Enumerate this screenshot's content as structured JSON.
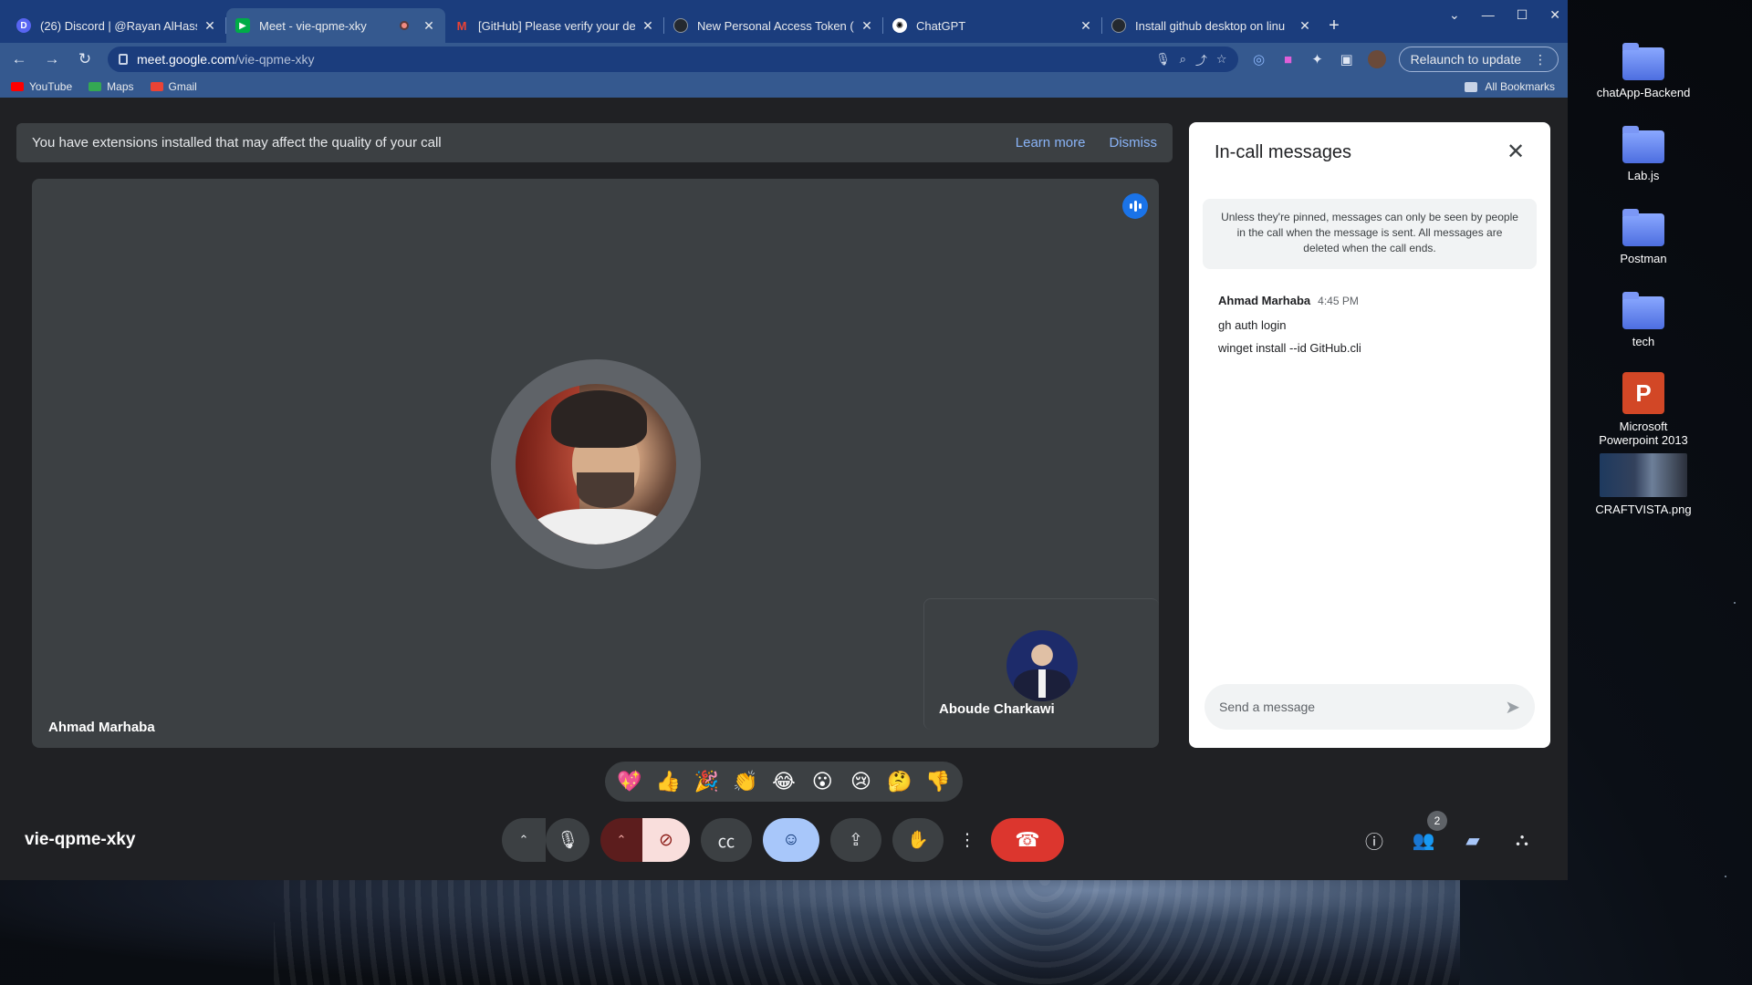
{
  "browser": {
    "tabs": [
      {
        "title": "(26) Discord | @Rayan AlHass",
        "icon": "discord-icon",
        "color": "#5865f2",
        "badge": "26",
        "active": false
      },
      {
        "title": "Meet - vie-qpme-xky",
        "icon": "meet-icon",
        "color": "#00ac47",
        "active": true,
        "recording": true
      },
      {
        "title": "[GitHub] Please verify your de",
        "icon": "gmail-icon",
        "color": "#ea4335",
        "active": false
      },
      {
        "title": "New Personal Access Token (",
        "icon": "github-icon",
        "color": "#24292f",
        "active": false
      },
      {
        "title": "ChatGPT",
        "icon": "chatgpt-icon",
        "color": "#ffffff",
        "active": false
      },
      {
        "title": "Install github desktop on linu",
        "icon": "github-icon",
        "color": "#24292f",
        "active": false
      }
    ],
    "address": {
      "host": "meet.google.com",
      "path": "/vie-qpme-xky"
    },
    "relaunch_label": "Relaunch to update",
    "bookmarks": [
      {
        "label": "YouTube",
        "icon": "youtube-icon",
        "color": "#ff0000"
      },
      {
        "label": "Maps",
        "icon": "maps-icon",
        "color": "#34a853"
      },
      {
        "label": "Gmail",
        "icon": "gmail-icon",
        "color": "#ea4335"
      }
    ],
    "all_bookmarks_label": "All Bookmarks"
  },
  "meet": {
    "banner": {
      "message": "You have extensions installed that may affect the quality of your call",
      "learn_more": "Learn more",
      "dismiss": "Dismiss"
    },
    "main_participant": "Ahmad Marhaba",
    "pip_participant": "Aboude Charkawi",
    "reactions": [
      "💖",
      "👍",
      "🎉",
      "👏",
      "😂",
      "😮",
      "😢",
      "🤔",
      "👎"
    ],
    "meeting_code": "vie-qpme-xky",
    "people_count": "2",
    "chat": {
      "title": "In-call messages",
      "info": "Unless they're pinned, messages can only be seen by people in the call when the message is sent. All messages are deleted when the call ends.",
      "messages": [
        {
          "sender": "Ahmad Marhaba",
          "time": "4:45 PM",
          "lines": [
            "gh auth login",
            "winget install --id GitHub.cli"
          ]
        }
      ],
      "input_placeholder": "Send a message"
    }
  },
  "desktop": {
    "icons": [
      {
        "label": "chatApp-Backend",
        "type": "folder"
      },
      {
        "label": "Lab.js",
        "type": "folder"
      },
      {
        "label": "Postman",
        "type": "folder"
      },
      {
        "label": "tech",
        "type": "folder"
      },
      {
        "label": "Microsoft Powerpoint 2013",
        "type": "powerpoint"
      },
      {
        "label": "CRAFTVISTA.png",
        "type": "image"
      }
    ]
  }
}
